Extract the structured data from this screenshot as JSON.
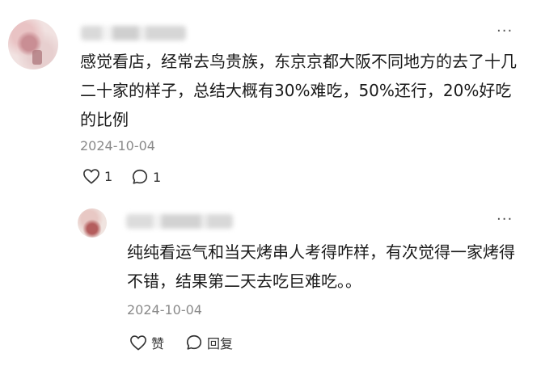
{
  "comment": {
    "more": "···",
    "content": "感觉看店，经常去鸟贵族，东京京都大阪不同地方的去了十几二十家的样子，总结大概有30%难吃，50%还行，20%好吃的比例",
    "date": "2024-10-04",
    "like_count": "1",
    "comment_count": "1"
  },
  "reply": {
    "more": "···",
    "content": "纯纯看运气和当天烤串人考得咋样，有次觉得一家烤得不错，结果第二天去吃巨难吃。。",
    "date": "2024-10-04",
    "like_label": "赞",
    "reply_label": "回复"
  }
}
